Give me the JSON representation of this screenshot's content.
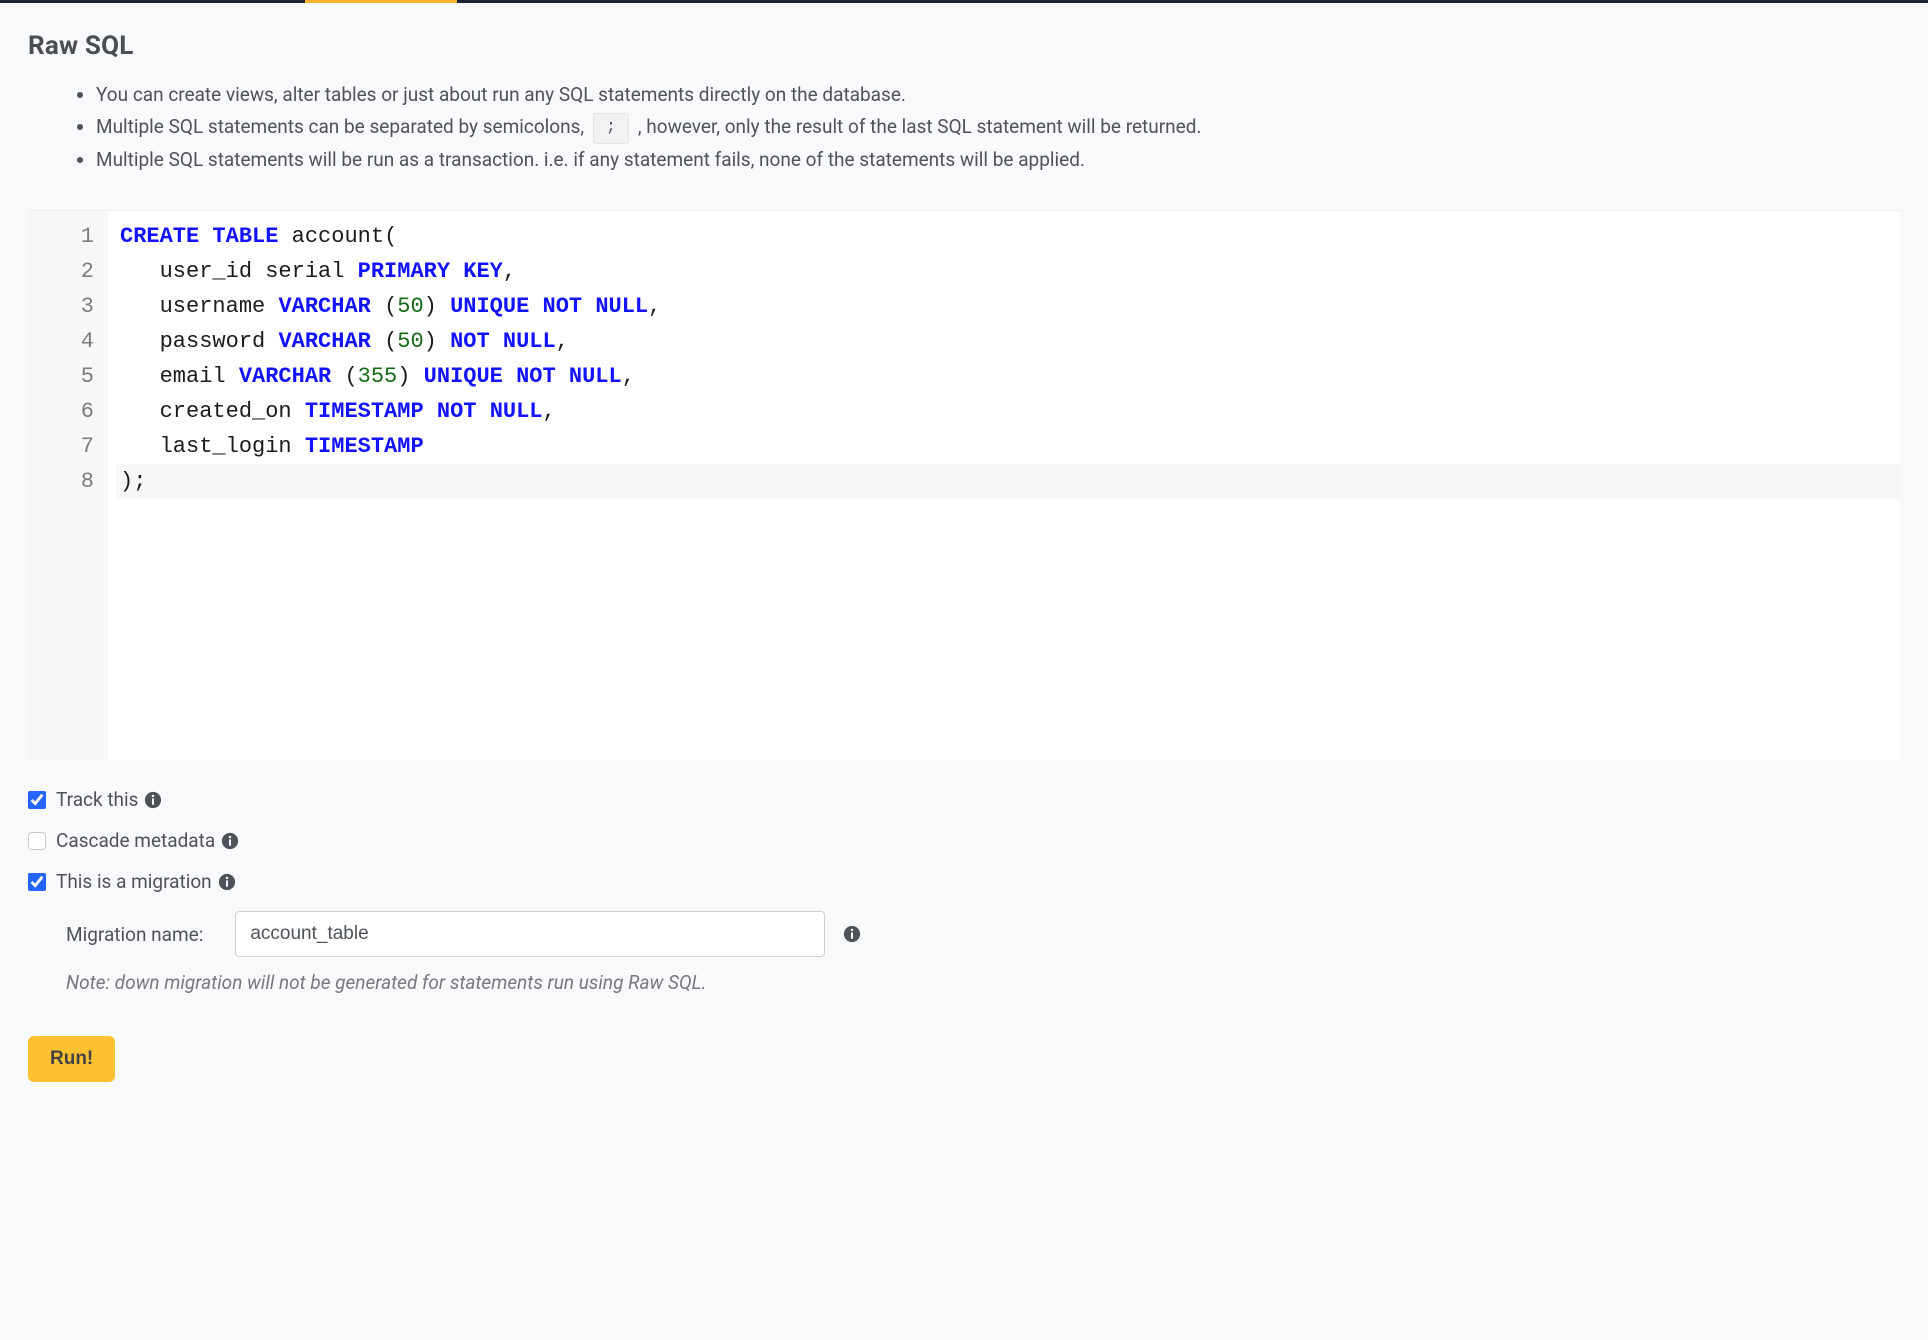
{
  "header": {
    "title": "Raw SQL"
  },
  "info": {
    "items": [
      "You can create views, alter tables or just about run any SQL statements directly on the database.",
      "Multiple SQL statements can be separated by semicolons, ",
      ", however, only the result of the last SQL statement will be returned.",
      "Multiple SQL statements will be run as a transaction. i.e. if any statement fails, none of the statements will be applied."
    ],
    "inline_code": ";"
  },
  "editor": {
    "line_numbers": [
      "1",
      "2",
      "3",
      "4",
      "5",
      "6",
      "7",
      "8"
    ],
    "lines": [
      [
        {
          "t": "CREATE",
          "c": "kw"
        },
        {
          "t": " ",
          "c": "plain"
        },
        {
          "t": "TABLE",
          "c": "kw"
        },
        {
          "t": " account",
          "c": "plain"
        },
        {
          "t": "(",
          "c": "paren"
        }
      ],
      [
        {
          "t": "   user_id serial ",
          "c": "plain"
        },
        {
          "t": "PRIMARY",
          "c": "kw"
        },
        {
          "t": " ",
          "c": "plain"
        },
        {
          "t": "KEY",
          "c": "kw"
        },
        {
          "t": ",",
          "c": "plain"
        }
      ],
      [
        {
          "t": "   username ",
          "c": "plain"
        },
        {
          "t": "VARCHAR",
          "c": "fn"
        },
        {
          "t": " ",
          "c": "plain"
        },
        {
          "t": "(",
          "c": "paren"
        },
        {
          "t": "50",
          "c": "num"
        },
        {
          "t": ")",
          "c": "paren"
        },
        {
          "t": " ",
          "c": "plain"
        },
        {
          "t": "UNIQUE",
          "c": "kw"
        },
        {
          "t": " ",
          "c": "plain"
        },
        {
          "t": "NOT",
          "c": "kw"
        },
        {
          "t": " ",
          "c": "plain"
        },
        {
          "t": "NULL",
          "c": "kw"
        },
        {
          "t": ",",
          "c": "plain"
        }
      ],
      [
        {
          "t": "   password ",
          "c": "plain"
        },
        {
          "t": "VARCHAR",
          "c": "fn"
        },
        {
          "t": " ",
          "c": "plain"
        },
        {
          "t": "(",
          "c": "paren"
        },
        {
          "t": "50",
          "c": "num"
        },
        {
          "t": ")",
          "c": "paren"
        },
        {
          "t": " ",
          "c": "plain"
        },
        {
          "t": "NOT",
          "c": "kw"
        },
        {
          "t": " ",
          "c": "plain"
        },
        {
          "t": "NULL",
          "c": "kw"
        },
        {
          "t": ",",
          "c": "plain"
        }
      ],
      [
        {
          "t": "   email ",
          "c": "plain"
        },
        {
          "t": "VARCHAR",
          "c": "fn"
        },
        {
          "t": " ",
          "c": "plain"
        },
        {
          "t": "(",
          "c": "paren"
        },
        {
          "t": "355",
          "c": "num"
        },
        {
          "t": ")",
          "c": "paren"
        },
        {
          "t": " ",
          "c": "plain"
        },
        {
          "t": "UNIQUE",
          "c": "kw"
        },
        {
          "t": " ",
          "c": "plain"
        },
        {
          "t": "NOT",
          "c": "kw"
        },
        {
          "t": " ",
          "c": "plain"
        },
        {
          "t": "NULL",
          "c": "kw"
        },
        {
          "t": ",",
          "c": "plain"
        }
      ],
      [
        {
          "t": "   created_on ",
          "c": "plain"
        },
        {
          "t": "TIMESTAMP",
          "c": "fn"
        },
        {
          "t": " ",
          "c": "plain"
        },
        {
          "t": "NOT",
          "c": "kw"
        },
        {
          "t": " ",
          "c": "plain"
        },
        {
          "t": "NULL",
          "c": "kw"
        },
        {
          "t": ",",
          "c": "plain"
        }
      ],
      [
        {
          "t": "   last_login ",
          "c": "plain"
        },
        {
          "t": "TIMESTAMP",
          "c": "fn"
        }
      ],
      [
        {
          "t": ")",
          "c": "paren"
        },
        {
          "t": ";",
          "c": "plain"
        }
      ]
    ]
  },
  "options": {
    "track_this": {
      "label": "Track this",
      "checked": true
    },
    "cascade_metadata": {
      "label": "Cascade metadata",
      "checked": false
    },
    "is_migration": {
      "label": "This is a migration",
      "checked": true
    },
    "migration_name_label": "Migration name:",
    "migration_name_value": "account_table",
    "note": "Note: down migration will not be generated for statements run using Raw SQL."
  },
  "actions": {
    "run_label": "Run!"
  }
}
